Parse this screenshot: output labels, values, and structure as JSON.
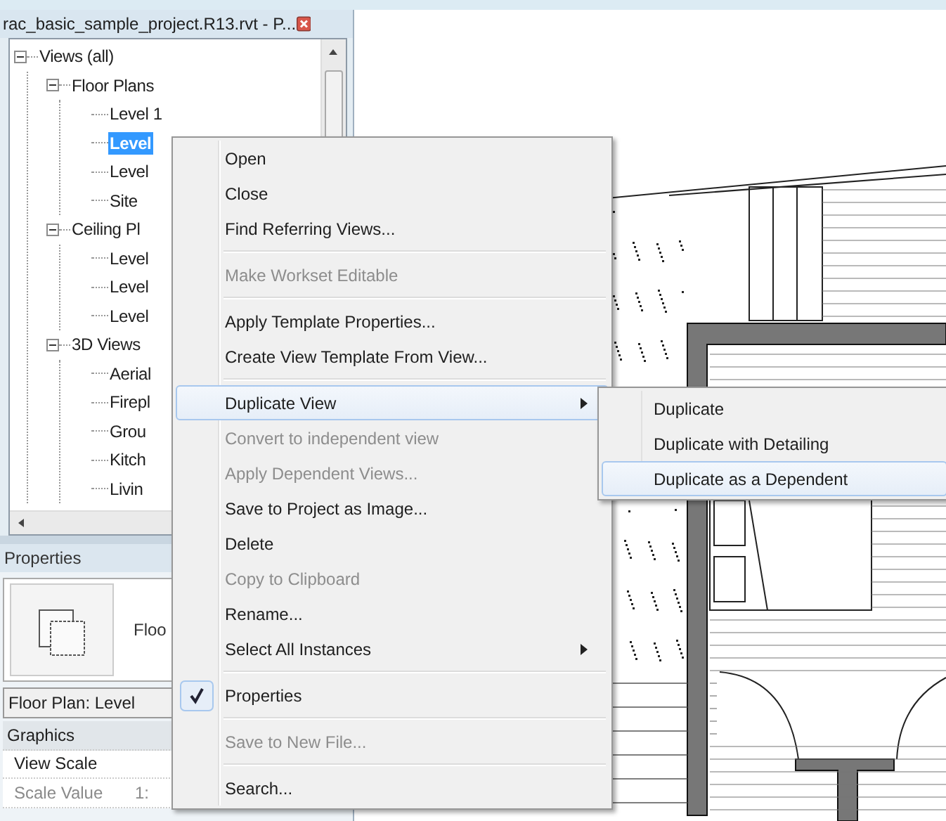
{
  "browser": {
    "title": "rac_basic_sample_project.R13.rvt - P...",
    "tree": [
      {
        "label": "Views (all)",
        "expanded": true,
        "selected": false,
        "children": [
          {
            "label": "Floor Plans",
            "expanded": true,
            "selected": false,
            "children": [
              {
                "label": "Level 1",
                "selected": false
              },
              {
                "label": "Level",
                "selected": true
              },
              {
                "label": "Level",
                "selected": false
              },
              {
                "label": "Site",
                "selected": false
              }
            ]
          },
          {
            "label": "Ceiling Pl",
            "expanded": true,
            "selected": false,
            "children": [
              {
                "label": "Level",
                "selected": false
              },
              {
                "label": "Level",
                "selected": false
              },
              {
                "label": "Level",
                "selected": false
              }
            ]
          },
          {
            "label": "3D Views",
            "expanded": true,
            "selected": false,
            "children": [
              {
                "label": "Aerial",
                "selected": false
              },
              {
                "label": "Firepl",
                "selected": false
              },
              {
                "label": "Grou",
                "selected": false
              },
              {
                "label": "Kitch",
                "selected": false
              },
              {
                "label": "Livin",
                "selected": false
              }
            ]
          }
        ]
      }
    ]
  },
  "properties": {
    "title": "Properties",
    "type_label": "Floo",
    "selector": "Floor Plan: Level",
    "rows": [
      {
        "kind": "group",
        "label": "Graphics"
      },
      {
        "kind": "param",
        "label": "View Scale",
        "value": "",
        "disabled": false
      },
      {
        "kind": "param",
        "label": "Scale Value",
        "value": "1:",
        "disabled": true
      }
    ]
  },
  "context_menu": {
    "items": [
      {
        "kind": "item",
        "label": "Open",
        "disabled": false,
        "submenu": false,
        "checked": false,
        "selected": false
      },
      {
        "kind": "item",
        "label": "Close",
        "disabled": false,
        "submenu": false,
        "checked": false,
        "selected": false
      },
      {
        "kind": "item",
        "label": "Find Referring Views...",
        "disabled": false,
        "submenu": false,
        "checked": false,
        "selected": false
      },
      {
        "kind": "separator"
      },
      {
        "kind": "item",
        "label": "Make Workset Editable",
        "disabled": true,
        "submenu": false,
        "checked": false,
        "selected": false
      },
      {
        "kind": "separator"
      },
      {
        "kind": "item",
        "label": "Apply Template Properties...",
        "disabled": false,
        "submenu": false,
        "checked": false,
        "selected": false
      },
      {
        "kind": "item",
        "label": "Create View Template From View...",
        "disabled": false,
        "submenu": false,
        "checked": false,
        "selected": false
      },
      {
        "kind": "separator"
      },
      {
        "kind": "item",
        "label": "Duplicate View",
        "disabled": false,
        "submenu": true,
        "checked": false,
        "selected": true
      },
      {
        "kind": "item",
        "label": "Convert to independent view",
        "disabled": true,
        "submenu": false,
        "checked": false,
        "selected": false
      },
      {
        "kind": "item",
        "label": "Apply Dependent Views...",
        "disabled": true,
        "submenu": false,
        "checked": false,
        "selected": false
      },
      {
        "kind": "item",
        "label": "Save to Project as Image...",
        "disabled": false,
        "submenu": false,
        "checked": false,
        "selected": false
      },
      {
        "kind": "item",
        "label": "Delete",
        "disabled": false,
        "submenu": false,
        "checked": false,
        "selected": false
      },
      {
        "kind": "item",
        "label": "Copy to Clipboard",
        "disabled": true,
        "submenu": false,
        "checked": false,
        "selected": false
      },
      {
        "kind": "item",
        "label": "Rename...",
        "disabled": false,
        "submenu": false,
        "checked": false,
        "selected": false
      },
      {
        "kind": "item",
        "label": "Select All Instances",
        "disabled": false,
        "submenu": true,
        "checked": false,
        "selected": false
      },
      {
        "kind": "separator"
      },
      {
        "kind": "item",
        "label": "Properties",
        "disabled": false,
        "submenu": false,
        "checked": true,
        "selected": false
      },
      {
        "kind": "separator"
      },
      {
        "kind": "item",
        "label": "Save to New File...",
        "disabled": true,
        "submenu": false,
        "checked": false,
        "selected": false
      },
      {
        "kind": "separator"
      },
      {
        "kind": "item",
        "label": "Search...",
        "disabled": false,
        "submenu": false,
        "checked": false,
        "selected": false
      }
    ]
  },
  "submenu": {
    "items": [
      {
        "label": "Duplicate",
        "selected": false
      },
      {
        "label": "Duplicate with Detailing",
        "selected": false
      },
      {
        "label": "Duplicate as a Dependent",
        "selected": true
      }
    ]
  }
}
